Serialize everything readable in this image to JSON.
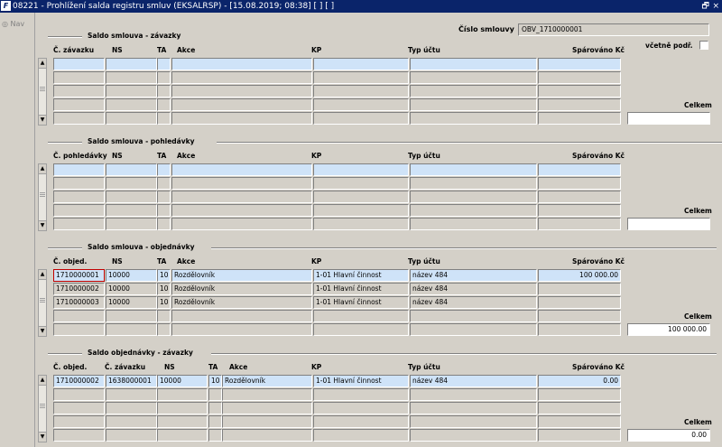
{
  "window": {
    "title": "08221 - Prohlížení salda registru smluv (EKSALRSP) - [15.08.2019; 08:38]  [ ]  [ ]",
    "app_icon": "app-icon",
    "restore": "🗗",
    "close": "×"
  },
  "nav": {
    "label": "Nav"
  },
  "header": {
    "contract_label": "Číslo smlouvy",
    "contract_value": "OBV_1710000001",
    "incl_sub_label": "včetně podř.",
    "incl_sub_checked": false
  },
  "sections": [
    {
      "title": "Saldo smlouva - závazky",
      "columns": [
        "Č. závazku",
        "NS",
        "TA",
        "Akce",
        "KP",
        "Typ účtu",
        "Spárováno Kč"
      ],
      "rows": [
        [
          "",
          "",
          "",
          "",
          "",
          "",
          ""
        ],
        [
          "",
          "",
          "",
          "",
          "",
          "",
          ""
        ],
        [
          "",
          "",
          "",
          "",
          "",
          "",
          ""
        ],
        [
          "",
          "",
          "",
          "",
          "",
          "",
          ""
        ],
        [
          "",
          "",
          "",
          "",
          "",
          "",
          ""
        ]
      ],
      "total_label": "Celkem",
      "total_value": ""
    },
    {
      "title": "Saldo smlouva - pohledávky",
      "columns": [
        "Č. pohledávky",
        "NS",
        "TA",
        "Akce",
        "KP",
        "Typ účtu",
        "Spárováno Kč"
      ],
      "rows": [
        [
          "",
          "",
          "",
          "",
          "",
          "",
          ""
        ],
        [
          "",
          "",
          "",
          "",
          "",
          "",
          ""
        ],
        [
          "",
          "",
          "",
          "",
          "",
          "",
          ""
        ],
        [
          "",
          "",
          "",
          "",
          "",
          "",
          ""
        ],
        [
          "",
          "",
          "",
          "",
          "",
          "",
          ""
        ]
      ],
      "total_label": "Celkem",
      "total_value": ""
    },
    {
      "title": "Saldo smlouva - objednávky",
      "columns": [
        "Č. objed.",
        "NS",
        "TA",
        "Akce",
        "KP",
        "Typ účtu",
        "Spárováno Kč"
      ],
      "rows": [
        [
          "1710000001",
          "10000",
          "10",
          "Rozdělovník",
          "1-01 Hlavní činnost",
          "název 484",
          "100 000.00"
        ],
        [
          "1710000002",
          "10000",
          "10",
          "Rozdělovník",
          "1-01 Hlavní činnost",
          "název 484",
          ""
        ],
        [
          "1710000003",
          "10000",
          "10",
          "Rozdělovník",
          "1-01 Hlavní činnost",
          "název 484",
          ""
        ],
        [
          "",
          "",
          "",
          "",
          "",
          "",
          ""
        ],
        [
          "",
          "",
          "",
          "",
          "",
          "",
          ""
        ]
      ],
      "total_label": "Celkem",
      "total_value": "100 000.00"
    },
    {
      "title": "Saldo objednávky - závazky",
      "columns": [
        "Č. objed.",
        "Č. závazku",
        "NS",
        "TA",
        "Akce",
        "KP",
        "Typ účtu",
        "Spárováno Kč"
      ],
      "rows": [
        [
          "1710000002",
          "1638000001",
          "10000",
          "10",
          "Rozdělovník",
          "1-01 Hlavní činnost",
          "název 484",
          "0.00"
        ],
        [
          "",
          "",
          "",
          "",
          "",
          "",
          "",
          ""
        ],
        [
          "",
          "",
          "",
          "",
          "",
          "",
          "",
          ""
        ],
        [
          "",
          "",
          "",
          "",
          "",
          "",
          "",
          ""
        ],
        [
          "",
          "",
          "",
          "",
          "",
          "",
          "",
          ""
        ]
      ],
      "total_label": "Celkem",
      "total_value": "0.00"
    }
  ],
  "colors": {
    "titlebar": "#0a246a",
    "selected_row": "#cfe3f8",
    "window": "#d4d0c8"
  }
}
